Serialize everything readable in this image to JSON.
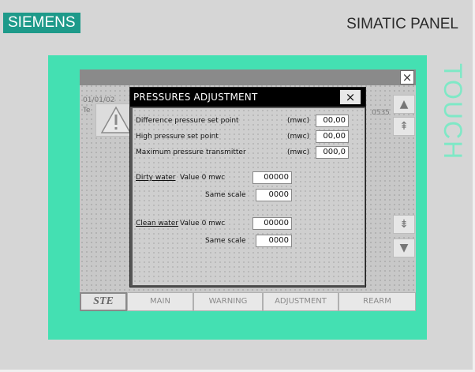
{
  "device": {
    "brand": "SIEMENS",
    "model": "SIMATIC PANEL",
    "touch_label": "TOUCH"
  },
  "screen": {
    "background_snippets": [
      "01/01/02",
      "Te",
      "0535"
    ],
    "nav_buttons": {
      "page_up": "▲",
      "page_up_fast": "⇞",
      "page_down_fast": "⇟",
      "page_down": "▼"
    },
    "bottom_bar": {
      "logo": "STE",
      "tabs": [
        "MAIN",
        "WARNING",
        "ADJUSTMENT",
        "REARM"
      ]
    }
  },
  "dialog": {
    "title": "PRESSURES ADJUSTMENT",
    "close_label": "×",
    "rows": [
      {
        "label": "Difference pressure set point",
        "unit": "(mwc)",
        "value": "00,00"
      },
      {
        "label": "High pressure set point",
        "unit": "(mwc)",
        "value": "00,00"
      },
      {
        "label": "Maximum pressure transmitter",
        "unit": "(mwc)",
        "value": "000,0"
      }
    ],
    "dirty_water": {
      "label": "Dirty water",
      "value_label": "Value 0 mwc",
      "value": "00000",
      "scale_label": "Same scale",
      "scale_value": "0000"
    },
    "clean_water": {
      "label": "Clean water",
      "value_label": "Value 0 mwc",
      "value": "00000",
      "scale_label": "Same scale",
      "scale_value": "0000"
    }
  },
  "colors": {
    "bezel": "#44e0b2",
    "brand_bg": "#1e9a8a",
    "dialog_title_bg": "#000000"
  }
}
